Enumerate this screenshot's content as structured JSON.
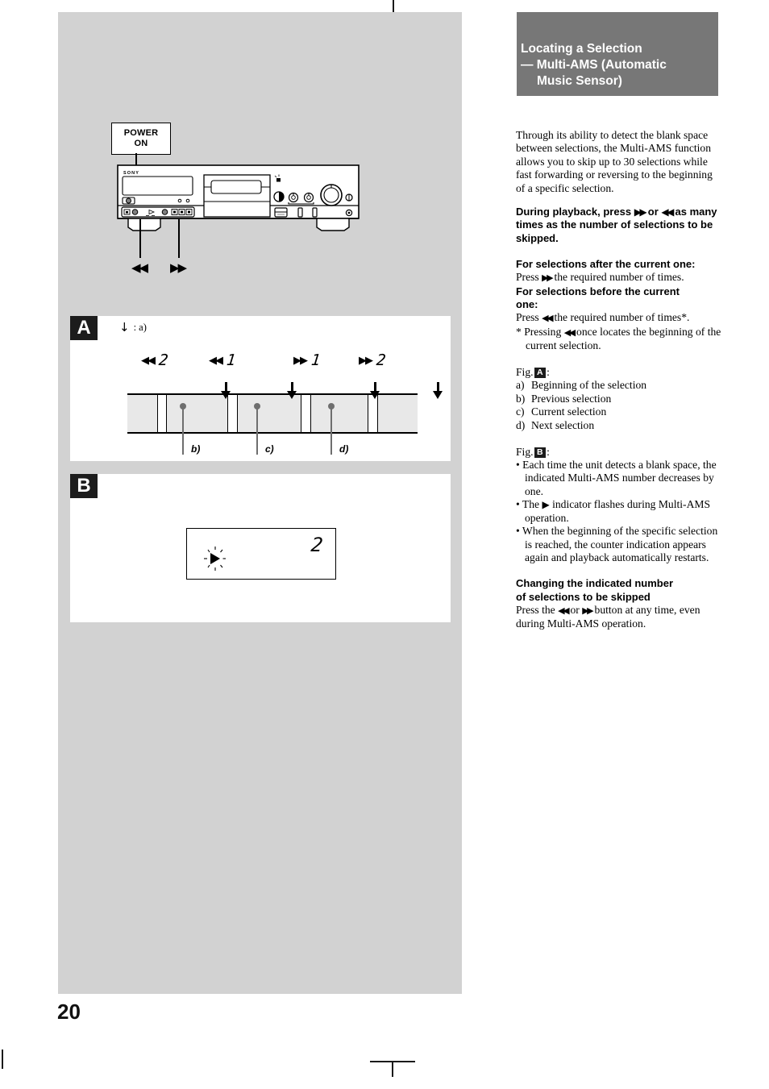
{
  "page": {
    "number": "20",
    "crop_marks": true
  },
  "illustration": {
    "power_callout": {
      "line1": "POWER",
      "line2": "ON"
    },
    "deck_brand": "SONY",
    "button_labels": {
      "rewind": "◀◀",
      "fastforward": "▶▶"
    }
  },
  "figure_a": {
    "tag": "A",
    "key_arrow": "↓",
    "key_text": ": a)",
    "operations": [
      {
        "icon": "rewind",
        "glyph": "◀◀",
        "count": "2"
      },
      {
        "icon": "rewind",
        "glyph": "◀◀",
        "count": "1"
      },
      {
        "icon": "fastforward",
        "glyph": "▶▶",
        "count": "1"
      },
      {
        "icon": "fastforward",
        "glyph": "▶▶",
        "count": "2"
      }
    ],
    "selection_labels": [
      "b)",
      "c)",
      "d)"
    ]
  },
  "figure_b": {
    "tag": "B",
    "display_number": "2",
    "play_indicator": "▶"
  },
  "right_column": {
    "header": {
      "line1": "Locating a Selection",
      "line2": "— Multi-AMS (Automatic",
      "line3": "Music Sensor)"
    },
    "intro": "Through its ability to detect the blank space between selections, the Multi-AMS function allows you to skip up to 30 selections while fast forwarding or reversing to the beginning of a specific selection.",
    "instruction_bold": {
      "part1": "During playback, press",
      "ff": "▶▶",
      "part2": "or",
      "rew": "◀◀",
      "part3": "as many times as the number of selections to be skipped."
    },
    "after_heading": "For selections after the current one:",
    "after_text_pre": "Press",
    "after_ff": "▶▶",
    "after_text_post": "the required number of times.",
    "before_heading_l1": "For selections before the current",
    "before_heading_l2": "one:",
    "before_text_pre": "Press",
    "before_rew": "◀◀",
    "before_text_post": "the required number of times*.",
    "footnote_pre": "* Pressing",
    "footnote_rew": "◀◀",
    "footnote_post": "once locates the beginning of the current selection.",
    "fig_a_ref": "Fig.",
    "fig_a_tag": "A",
    "fig_a_colon": ":",
    "fig_a_items": [
      {
        "label": "a)",
        "text": "Beginning of the selection"
      },
      {
        "label": "b)",
        "text": "Previous selection"
      },
      {
        "label": "c)",
        "text": "Current selection"
      },
      {
        "label": "d)",
        "text": "Next selection"
      }
    ],
    "fig_b_ref": "Fig.",
    "fig_b_tag": "B",
    "fig_b_colon": ":",
    "fig_b_bullets": [
      "• Each time the unit detects a blank space, the indicated Multi-AMS number decreases by one.",
      "• When the beginning of the specific selection is reached, the counter indication appears again and playback automatically restarts."
    ],
    "fig_b_bullet_play_pre": "• The",
    "fig_b_bullet_play_icon": "▶",
    "fig_b_bullet_play_post": "indicator flashes during Multi-AMS operation.",
    "changing_heading_l1": "Changing the indicated number",
    "changing_heading_l2": "of selections to be skipped",
    "changing_text_pre": "Press the",
    "changing_rew": "◀◀",
    "changing_or": "or",
    "changing_ff": "▶▶",
    "changing_text_post": "button at any time, even during Multi-AMS operation."
  },
  "colors": {
    "panel_gray": "#d2d2d2",
    "header_gray": "#777777",
    "tag_black": "#1c1c1c",
    "strip_fill": "#e8e8e8",
    "pin_gray": "#6e6e6e"
  }
}
